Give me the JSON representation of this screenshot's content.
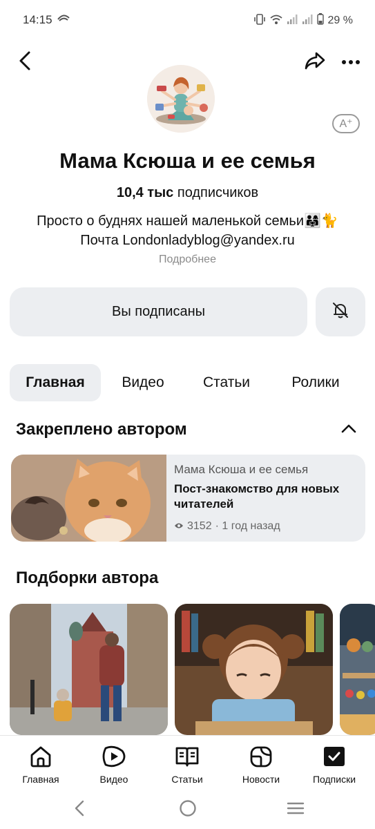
{
  "status_bar": {
    "time": "14:15",
    "battery": "29 %"
  },
  "channel": {
    "title": "Мама Ксюша и ее семья",
    "subscribers_count": "10,4 тыс",
    "subscribers_label": "подписчиков",
    "description_line1": "Просто о буднях нашей маленькой семьи👨‍👩‍👧🐈",
    "description_line2": "Почта Londonladyblog@yandex.ru",
    "more_link": "Подробнее",
    "font_badge": "A⁺"
  },
  "actions": {
    "subscribed_label": "Вы подписаны"
  },
  "tabs": [
    {
      "label": "Главная",
      "active": true
    },
    {
      "label": "Видео",
      "active": false
    },
    {
      "label": "Статьи",
      "active": false
    },
    {
      "label": "Ролики",
      "active": false
    }
  ],
  "pinned": {
    "heading": "Закреплено автором",
    "card": {
      "channel": "Мама Ксюша и ее семья",
      "title": "Пост-знакомство для новых читателей",
      "views": "3152",
      "time": "· 1 год назад"
    }
  },
  "collections": {
    "heading": "Подборки автора"
  },
  "bottom_nav": [
    {
      "label": "Главная",
      "icon": "home-icon"
    },
    {
      "label": "Видео",
      "icon": "video-icon"
    },
    {
      "label": "Статьи",
      "icon": "articles-icon"
    },
    {
      "label": "Новости",
      "icon": "news-icon"
    },
    {
      "label": "Подписки",
      "icon": "subscriptions-icon"
    }
  ],
  "colors": {
    "accent_bg": "#eceef1",
    "text": "#111111",
    "muted": "#8a8a8a"
  }
}
